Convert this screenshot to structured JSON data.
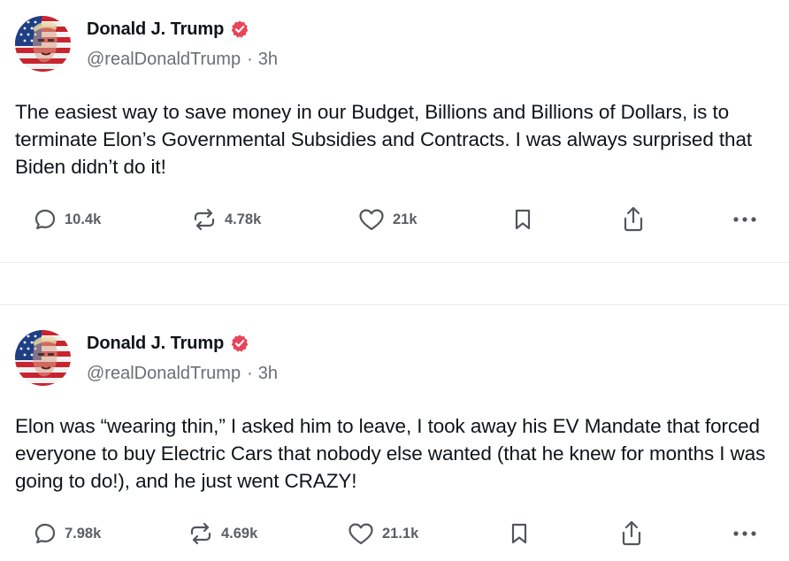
{
  "posts": [
    {
      "author": {
        "display_name": "Donald J. Trump",
        "handle": "@realDonaldTrump",
        "timestamp": "3h",
        "separator": "·"
      },
      "text": "The easiest way to save money in our Budget, Billions and Billions of Dollars, is to terminate Elon’s Governmental Subsidies and Contracts. I was always surprised that Biden didn’t do it!",
      "stats": {
        "replies": "10.4k",
        "reposts": "4.78k",
        "likes": "21k"
      }
    },
    {
      "author": {
        "display_name": "Donald J. Trump",
        "handle": "@realDonaldTrump",
        "timestamp": "3h",
        "separator": "·"
      },
      "text": "Elon was “wearing thin,” I asked him to leave, I took away his EV Mandate that forced everyone to buy Electric Cars that nobody else wanted (that he knew for months I was going to do!), and he just went CRAZY!",
      "stats": {
        "replies": "7.98k",
        "reposts": "4.69k",
        "likes": "21.1k"
      }
    }
  ],
  "icons": {
    "reply": "speech-bubble-icon",
    "repost": "repost-arrows-icon",
    "like": "heart-icon",
    "bookmark": "bookmark-icon",
    "share": "share-upload-icon",
    "more": "ellipsis-icon",
    "verified": "verified-badge-icon"
  },
  "colors": {
    "verified_badge": "#e8445a",
    "text": "#0f1419",
    "secondary_text": "#6b6e75",
    "icon": "#53565c",
    "divider": "#e9eaec"
  }
}
